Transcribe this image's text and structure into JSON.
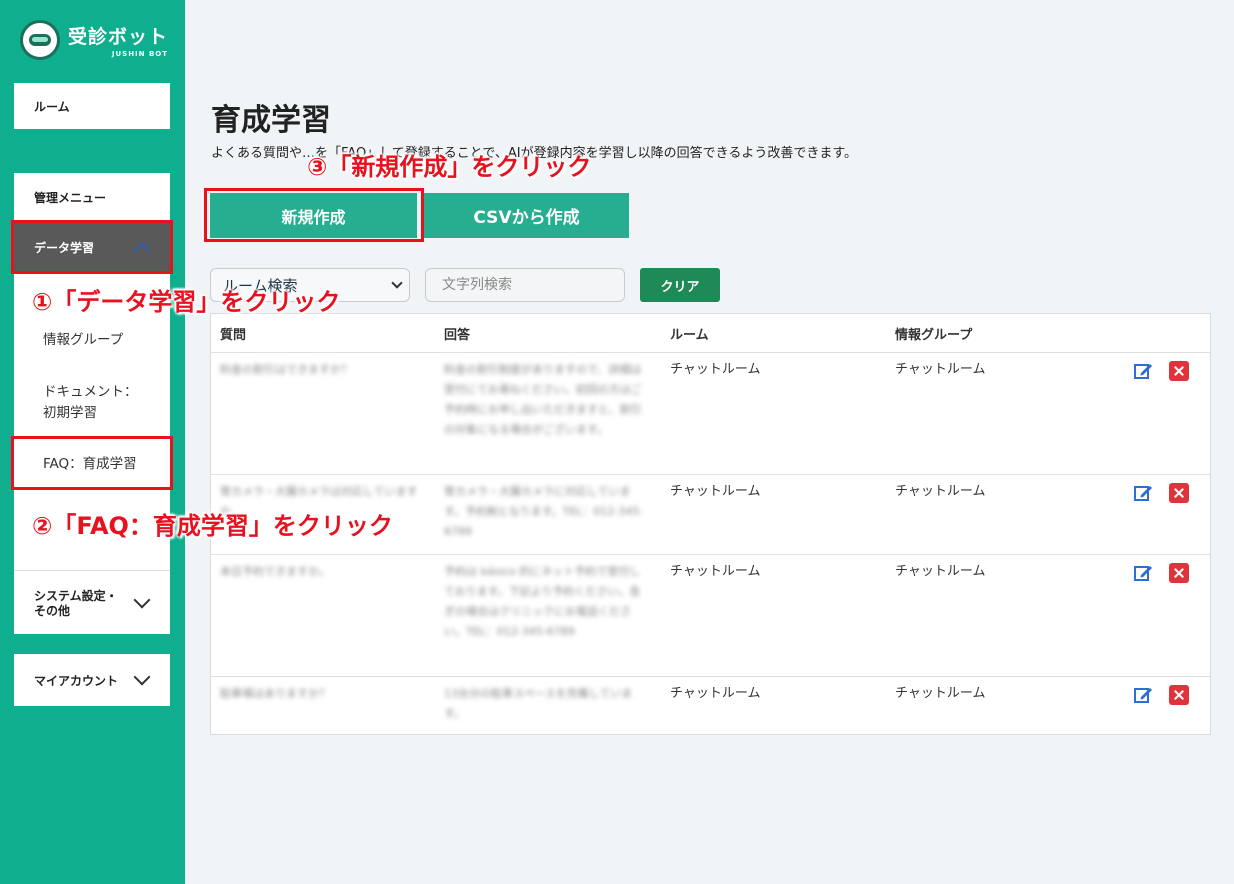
{
  "brand": {
    "title": "受診ボット",
    "subtitle": "JUSHIN BOT"
  },
  "sidebar": {
    "room": "ルーム",
    "admin_menu": "管理メニュー",
    "data_learning": "データ学習",
    "info_group": "情報グループ",
    "document_line1": "ドキュメント：",
    "document_line2": "初期学習",
    "faq": "FAQ：育成学習",
    "system_line1": "システム設定・",
    "system_line2": "その他",
    "my_account": "マイアカウント"
  },
  "main": {
    "title": "育成学習",
    "description": "よくある質問や…を「FAQ」して登録することで、AIが登録内容を学習し以降の回答できるよう改善できます。",
    "new_button": "新規作成",
    "csv_button": "CSVから作成",
    "room_select_value": "ルーム検索",
    "search_placeholder": "文字列検索",
    "clear_button": "クリア"
  },
  "table": {
    "headers": [
      "質問",
      "回答",
      "ルーム",
      "情報グループ"
    ],
    "rows": [
      {
        "question": "料金の割引はできますか？",
        "answer": "料金の割引制度がありますので、詳細は受付にてお尋ねください。初回の方はご予約時にお申し出いただきますと、割引の対象になる場合がございます。",
        "room": "チャットルーム",
        "group": "チャットルーム"
      },
      {
        "question": "胃カメラ・大腸カメラは対応していますか",
        "answer": "胃カメラ・大腸カメラに対応しています。予約制となります。TEL：012-345-6789",
        "room": "チャットルーム",
        "group": "チャットルーム"
      },
      {
        "question": "本日予約できますか。",
        "answer": "予約は básico 的にネット予約で受付しております。下記より予約ください。急ぎの場合はクリニックにお電話ください。TEL：012-345-6789",
        "room": "チャットルーム",
        "group": "チャットルーム"
      },
      {
        "question": "駐車場はありますか？",
        "answer": "13台分の駐車スペースを完備しています。",
        "room": "チャットルーム",
        "group": "チャットルーム"
      }
    ]
  },
  "annotations": {
    "step1": "①「データ学習」をクリック",
    "step2": "②「FAQ：育成学習」をクリック",
    "step3": "③「新規作成」をクリック"
  },
  "colors": {
    "sidebar": "#0fae8e",
    "button": "#27ad90",
    "clear": "#1f8a55",
    "annotation": "#e8121e",
    "delete": "#e0343c"
  }
}
